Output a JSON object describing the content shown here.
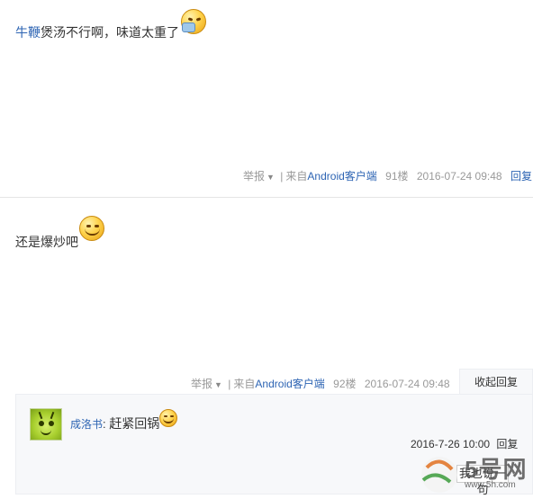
{
  "post91": {
    "user": "牛鞭",
    "text": "煲汤不行啊，味道太重了",
    "emoji": "sick-face-emoji",
    "report_label": "举报",
    "source_prefix": "来自",
    "source_client": "Android客户端",
    "floor": "91楼",
    "time": "2016-07-24 09:48",
    "reply_label": "回复"
  },
  "post92": {
    "text": "还是爆炒吧",
    "emoji": "grin-emoji",
    "report_label": "举报",
    "source_prefix": "来自",
    "source_client": "Android客户端",
    "floor": "92楼",
    "time": "2016-07-24 09:48",
    "collapse_label": "收起回复"
  },
  "sub_reply": {
    "user": "成洛书",
    "separator": ":",
    "text": "赶紧回锅",
    "emoji": "grin-emoji",
    "time": "2016-7-26 10:00",
    "reply_label": "回复",
    "input_hint": "我也说一句"
  },
  "watermark": {
    "brand": "5号网",
    "url": "www.5h.com"
  },
  "colors": {
    "link": "#2d64b3",
    "meta": "#999999",
    "panel_bg": "#f7f8fa",
    "divider": "#e5e5e5"
  }
}
